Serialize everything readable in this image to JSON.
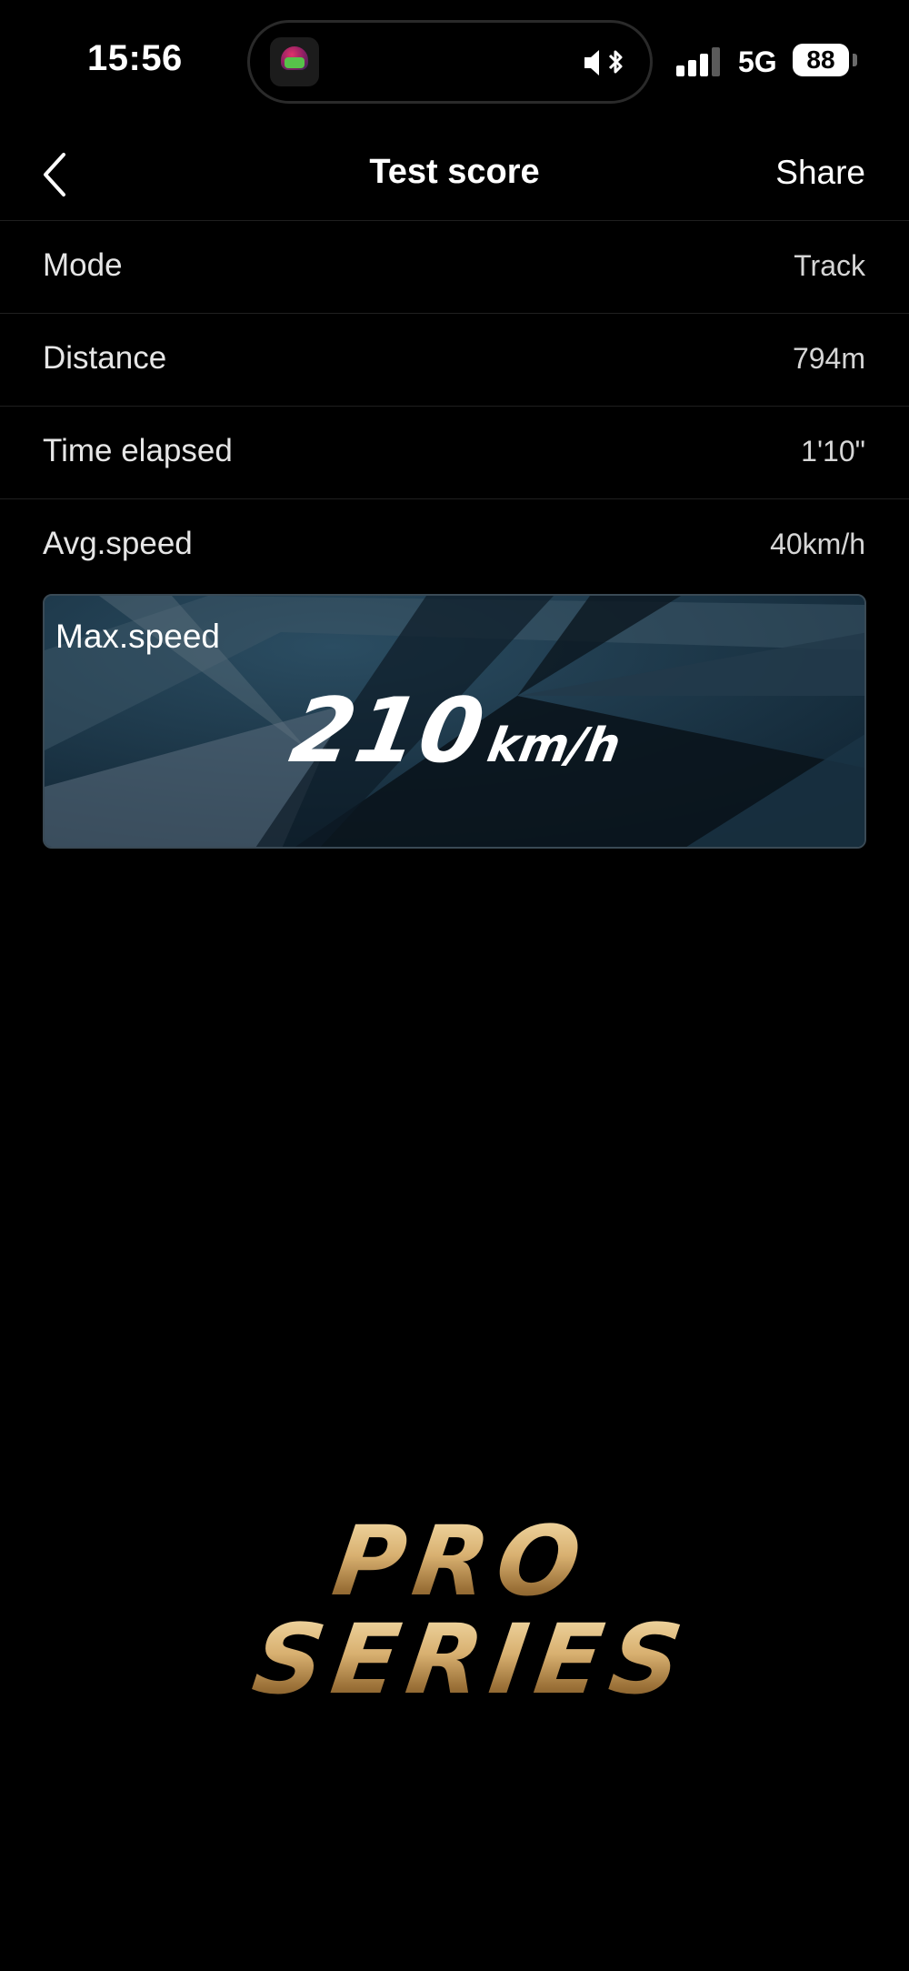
{
  "status_bar": {
    "time": "15:56",
    "network": "5G",
    "battery": "88",
    "icons": [
      "app-helmet-icon",
      "mute-icon",
      "bluetooth-icon",
      "signal-icon",
      "battery-icon"
    ]
  },
  "nav": {
    "back_icon": "chevron-left-icon",
    "title": "Test score",
    "share_label": "Share"
  },
  "stats": [
    {
      "label": "Mode",
      "value": "Track"
    },
    {
      "label": "Distance",
      "value": "794m"
    },
    {
      "label": "Time elapsed",
      "value": "1'10\""
    },
    {
      "label": "Avg.speed",
      "value": "40km/h"
    }
  ],
  "max_speed": {
    "label": "Max.speed",
    "value": "210",
    "unit": "km/h"
  },
  "brand": {
    "line1": "PRO",
    "line2": "SERIES"
  },
  "colors": {
    "background": "#000000",
    "text": "#ffffff",
    "divider": "#1f1f1f",
    "card_bg": "#163040",
    "brand_gold": "#d8b070"
  }
}
